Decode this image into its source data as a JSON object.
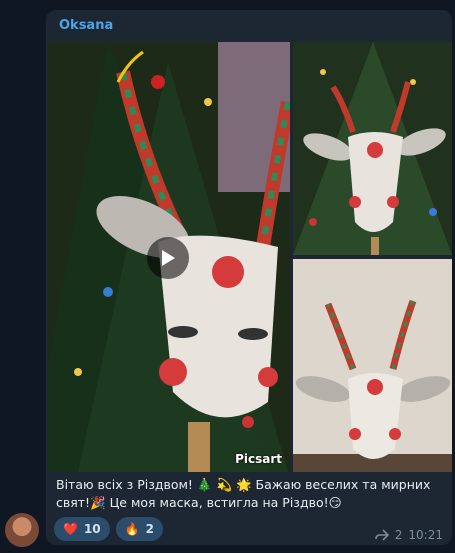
{
  "message": {
    "sender": "Oksana",
    "caption_line1": "Вітаю всіх з Різдвом! 🎄 💫 🌟  Бажаю веселих та мирних",
    "caption_line2": "свят!🎉 Це моя маска, встигла на Різдво!😏",
    "watermark": "Picsart",
    "reactions": [
      {
        "emoji": "❤️",
        "count": "10"
      },
      {
        "emoji": "🔥",
        "count": "2"
      }
    ],
    "forwards": "2",
    "time": "10:21"
  },
  "colors": {
    "accent": "#4ea3e6",
    "bubble": "#1c2733",
    "background": "#0f1722",
    "reaction_bg": "#2b4d6b"
  },
  "icons": {
    "play": "play-icon",
    "forward": "forward-icon"
  }
}
